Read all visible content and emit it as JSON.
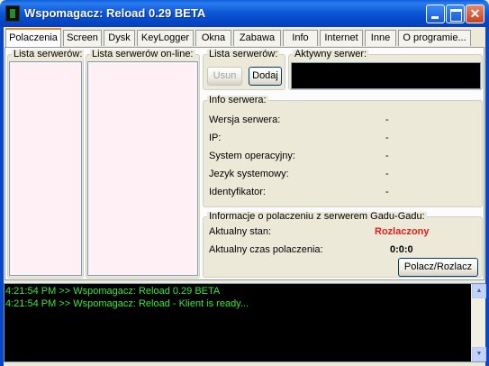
{
  "window": {
    "title": "Wspomagacz: Reload 0.29 BETA",
    "close_glyph": "✕"
  },
  "tabs": [
    {
      "label": "Polaczenia",
      "active": true
    },
    {
      "label": "Screen"
    },
    {
      "label": "Dysk"
    },
    {
      "label": "KeyLogger"
    },
    {
      "label": "Okna"
    },
    {
      "label": "Zabawa"
    },
    {
      "label": "Info"
    },
    {
      "label": "Internet"
    },
    {
      "label": "Inne"
    },
    {
      "label": "O programie..."
    }
  ],
  "servers": {
    "list_title": "Lista serwerów:",
    "online_title": "Lista serwerów on-line:",
    "controls_title": "Lista serwerów:",
    "remove_label": "Usun",
    "add_label": "Dodaj",
    "active_title": "Aktywny serwer:"
  },
  "server_info": {
    "title": "Info serwera:",
    "rows": [
      {
        "label": "Wersja serwera:",
        "value": "-"
      },
      {
        "label": "IP:",
        "value": "-"
      },
      {
        "label": "System operacyjny:",
        "value": "-"
      },
      {
        "label": "Jezyk systemowy:",
        "value": "-"
      },
      {
        "label": "Identyfikator:",
        "value": "-"
      }
    ]
  },
  "gg": {
    "title": "Informacje o polaczeniu z serwerem Gadu-Gadu:",
    "status_label": "Aktualny stan:",
    "status_value": "Rozlaczony",
    "status_color": "#E0201B",
    "time_label": "Aktualny czas polaczenia:",
    "time_value": "0:0:0",
    "connect_label": "Polacz/Rozlacz"
  },
  "log": {
    "text_color": "#3CE63C",
    "lines": [
      "4:21:54 PM >> Wspomagacz: Reload 0.29 BETA",
      "4:21:54 PM >> Wspomagacz: Reload - Klient is ready..."
    ],
    "scroll_up_glyph": "▲",
    "scroll_down_glyph": "▼"
  },
  "icons": [
    "app-icon",
    "minimize-icon",
    "maximize-icon",
    "close-icon",
    "scroll-up-icon",
    "scroll-down-icon"
  ]
}
